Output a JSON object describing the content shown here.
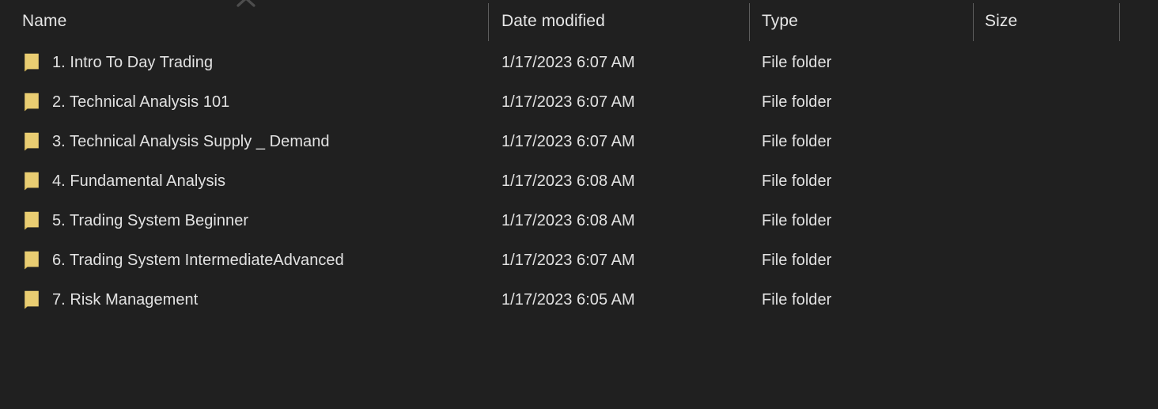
{
  "window": {
    "view": "Details",
    "background_color": "#202020",
    "text_color": "#e2e2e2"
  },
  "columns": {
    "sort": {
      "column": "Name",
      "direction": "ascending",
      "indicator_icon": "chevron-up-icon"
    },
    "headers": [
      {
        "id": "name",
        "label": "Name"
      },
      {
        "id": "date_modified",
        "label": "Date modified"
      },
      {
        "id": "type",
        "label": "Type"
      },
      {
        "id": "size",
        "label": "Size"
      }
    ]
  },
  "files": [
    {
      "icon": "folder-icon",
      "name": "1. Intro To Day Trading",
      "date_modified": "1/17/2023 6:07 AM",
      "type": "File folder",
      "size": ""
    },
    {
      "icon": "folder-icon",
      "name": "2. Technical Analysis 101",
      "date_modified": "1/17/2023 6:07 AM",
      "type": "File folder",
      "size": ""
    },
    {
      "icon": "folder-icon",
      "name": "3. Technical Analysis Supply _ Demand",
      "date_modified": "1/17/2023 6:07 AM",
      "type": "File folder",
      "size": ""
    },
    {
      "icon": "folder-icon",
      "name": "4. Fundamental Analysis",
      "date_modified": "1/17/2023 6:08 AM",
      "type": "File folder",
      "size": ""
    },
    {
      "icon": "folder-icon",
      "name": "5. Trading System Beginner",
      "date_modified": "1/17/2023 6:08 AM",
      "type": "File folder",
      "size": ""
    },
    {
      "icon": "folder-icon",
      "name": "6. Trading System IntermediateAdvanced",
      "date_modified": "1/17/2023 6:07 AM",
      "type": "File folder",
      "size": ""
    },
    {
      "icon": "folder-icon",
      "name": "7. Risk Management",
      "date_modified": "1/17/2023 6:05 AM",
      "type": "File folder",
      "size": ""
    }
  ],
  "colors": {
    "folder_fill": "#e9cd72",
    "folder_fill_dark": "#d8b955",
    "divider": "#5d5d5d",
    "sort_caret": "#4a4a4a"
  }
}
